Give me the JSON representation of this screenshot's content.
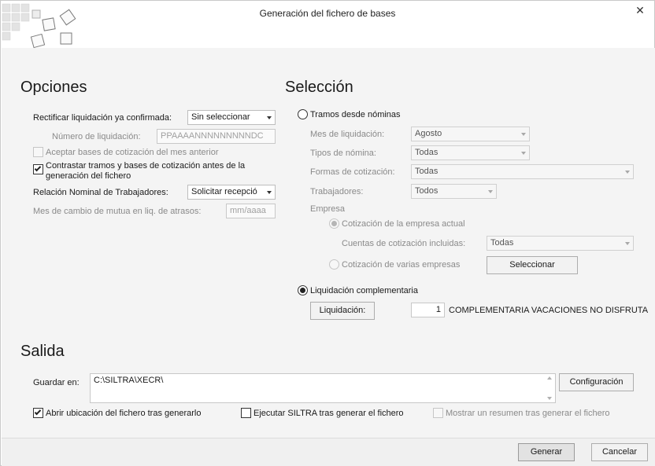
{
  "window": {
    "title": "Generación del fichero de bases",
    "close_glyph": "✕"
  },
  "opciones": {
    "title": "Opciones",
    "rectificar_label": "Rectificar liquidación ya confirmada:",
    "rectificar_value": "Sin seleccionar",
    "numero_label": "Número de liquidación:",
    "numero_placeholder": "PPAAAANNNNNNNNNDC",
    "aceptar_label": "Aceptar bases de cotización del mes anterior",
    "contrastar_label_1": "Contrastar tramos y bases de cotización antes de la",
    "contrastar_label_2": "generación del fichero",
    "relacion_label": "Relación Nominal de Trabajadores:",
    "relacion_value": "Solicitar recepció",
    "mes_cambio_label": "Mes de cambio de mutua en liq. de atrasos:",
    "mes_cambio_placeholder": "mm/aaaa"
  },
  "seleccion": {
    "title": "Selección",
    "tramos_label": "Tramos desde nóminas",
    "mes_liq_label": "Mes de liquidación:",
    "mes_liq_value": "Agosto",
    "tipos_label": "Tipos de nómina:",
    "tipos_value": "Todas",
    "formas_label": "Formas de cotización:",
    "formas_value": "Todas",
    "trabajadores_label": "Trabajadores:",
    "trabajadores_value": "Todos",
    "empresa_label": "Empresa",
    "cot_actual_label": "Cotización de la empresa actual",
    "cuentas_label": "Cuentas de cotización incluidas:",
    "cuentas_value": "Todas",
    "cot_varias_label": "Cotización de varias empresas",
    "seleccionar_button": "Seleccionar",
    "liq_comp_label": "Liquidación complementaria",
    "liquidacion_button": "Liquidación:",
    "liquidacion_number": "1",
    "liquidacion_desc": "COMPLEMENTARIA VACACIONES NO DISFRUTA"
  },
  "salida": {
    "title": "Salida",
    "guardar_label": "Guardar en:",
    "guardar_value": "C:\\SILTRA\\XECR\\",
    "configuracion_button": "Configuración",
    "abrir_label": "Abrir ubicación del fichero tras generarlo",
    "ejecutar_label": "Ejecutar SILTRA tras generar el fichero",
    "mostrar_label": "Mostrar un resumen tras generar el fichero"
  },
  "footer": {
    "generar_button": "Generar",
    "cancelar_button": "Cancelar"
  },
  "state": {
    "aceptar_checked": false,
    "contrastar_checked": true,
    "tramos_selected": false,
    "cot_actual_selected": true,
    "cot_varias_selected": false,
    "liq_comp_selected": true,
    "abrir_checked": true,
    "ejecutar_checked": false,
    "mostrar_checked": false
  }
}
